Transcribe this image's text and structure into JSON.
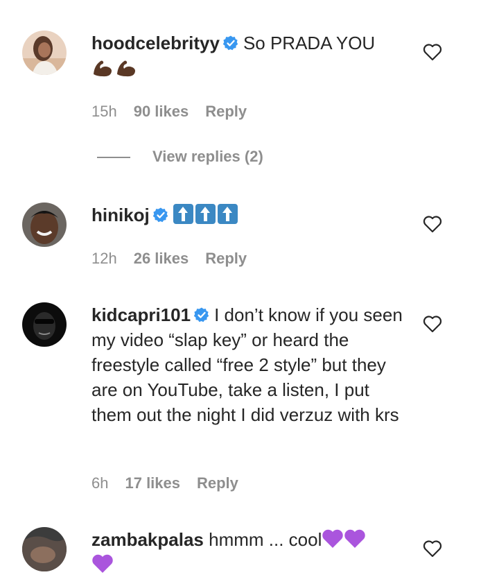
{
  "comments": [
    {
      "username": "hoodcelebrityy",
      "text": "So PRADA YOU",
      "emoji": [
        "flexed-biceps",
        "flexed-biceps"
      ],
      "time": "15h",
      "likes": "90 likes",
      "reply": "Reply",
      "view_replies": "View replies (2)"
    },
    {
      "username": "hinikoj",
      "text": "",
      "emoji": [
        "up-arrow",
        "up-arrow",
        "up-arrow"
      ],
      "time": "12h",
      "likes": "26 likes",
      "reply": "Reply"
    },
    {
      "username": "kidcapri101",
      "text": "I don’t know if you seen my video “slap key” or heard the freestyle called “free 2 style” but they are on YouTube, take a listen, I put them out the night I did verzuz with krs",
      "time": "6h",
      "likes": "17 likes",
      "reply": "Reply"
    },
    {
      "username": "zambakpalas",
      "text": "hmmm ... cool",
      "emoji": [
        "purple-heart",
        "purple-heart",
        "purple-heart"
      ]
    }
  ],
  "colors": {
    "verified_badge": "#3897f0",
    "meta_text": "#8e8e8e",
    "primary_text": "#262626",
    "purple_heart": "#aa55dd",
    "arrow_emoji": "#3b88c3"
  }
}
